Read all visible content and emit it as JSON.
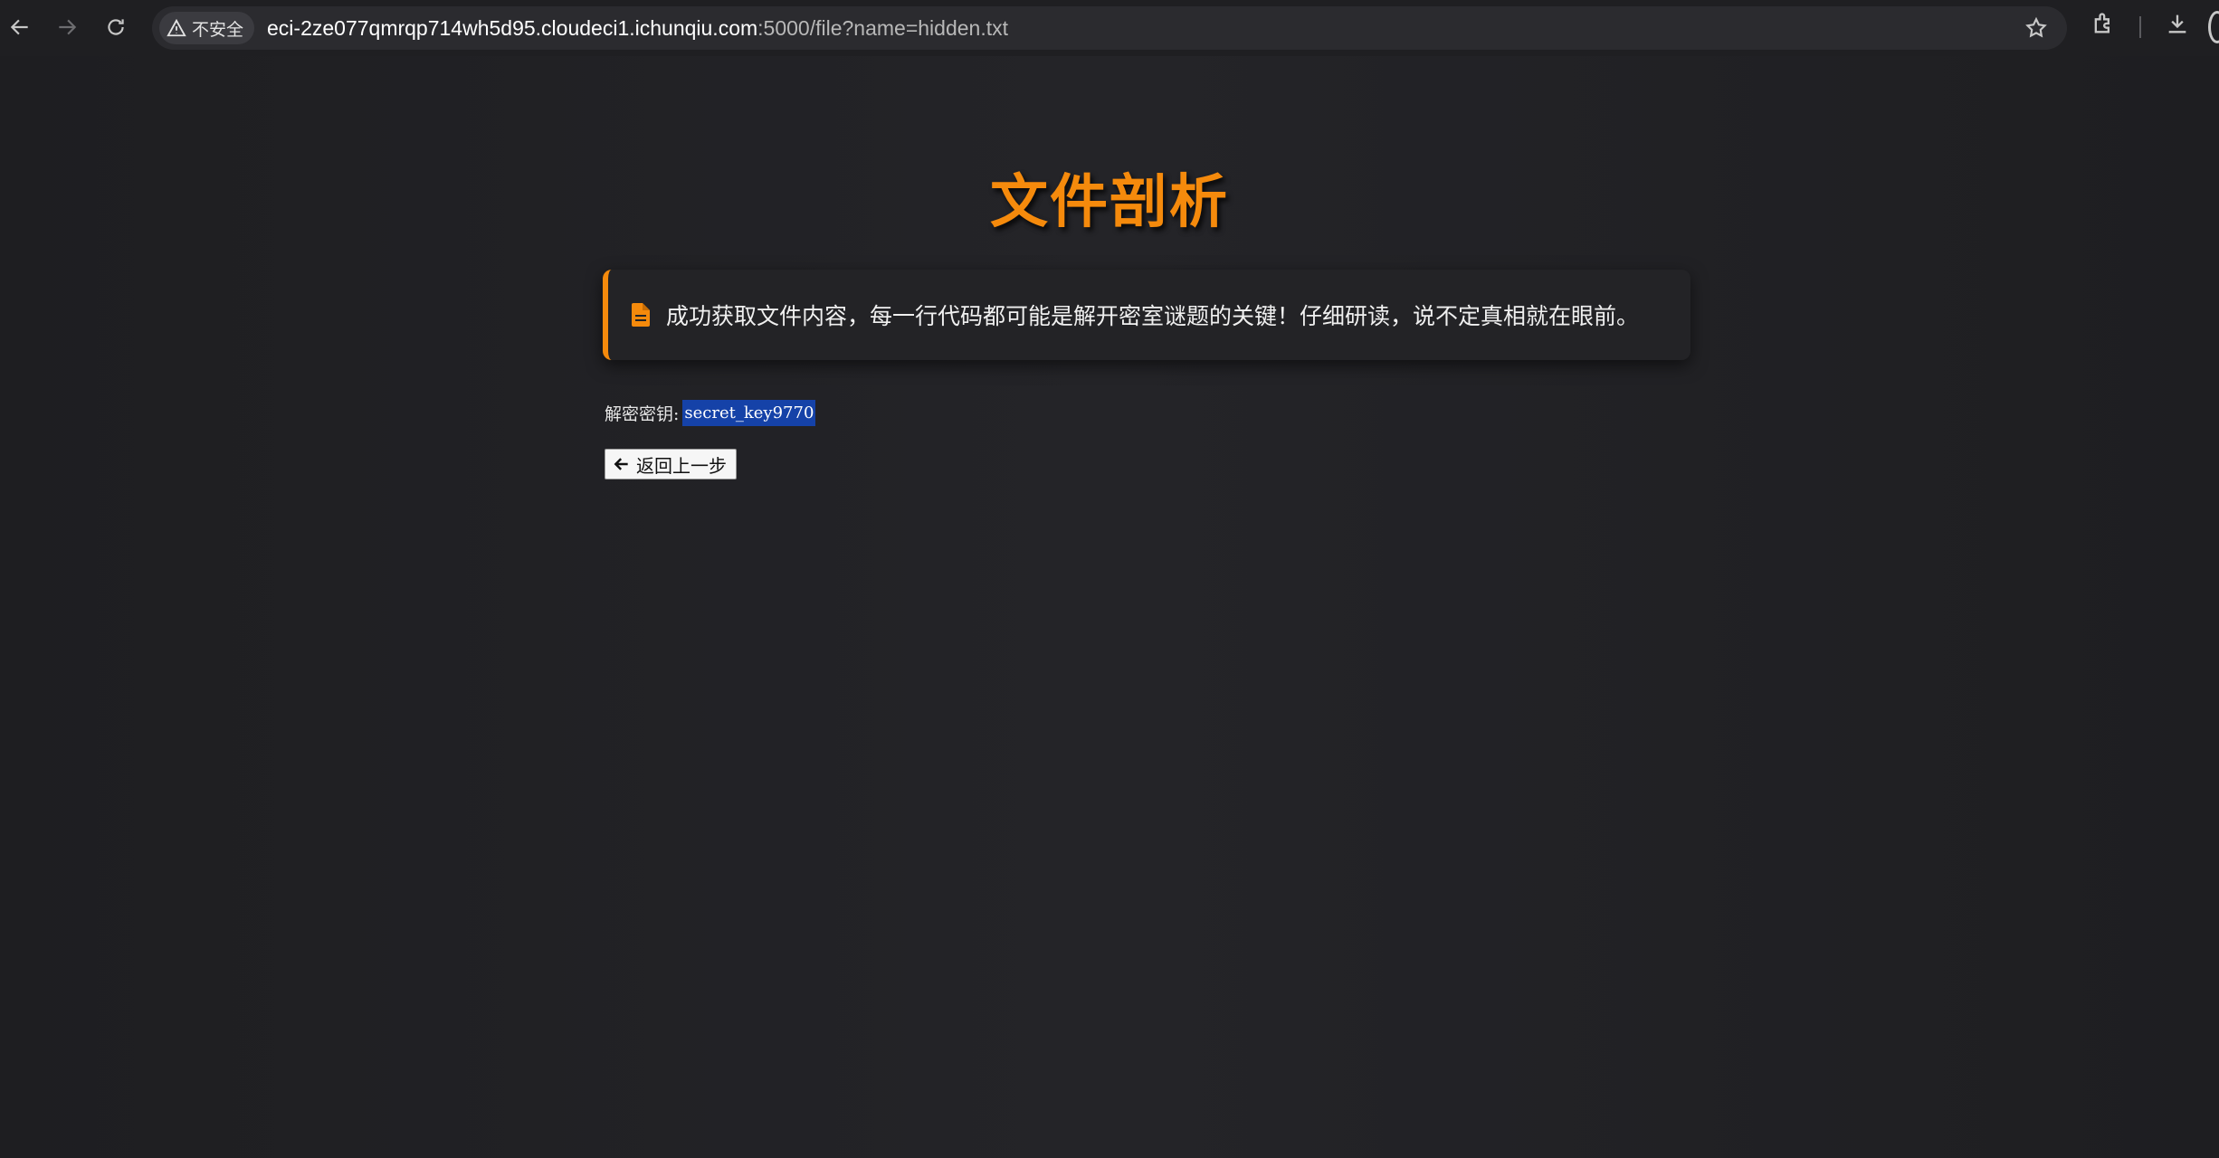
{
  "browser": {
    "security_label": "不安全",
    "url_host": "eci-2ze077qmrqp714wh5d95.cloudeci1.ichunqiu.com",
    "url_path": ":5000/file?name=hidden.txt"
  },
  "page": {
    "title": "文件剖析",
    "notice_text": "成功获取文件内容，每一行代码都可能是解开密室谜题的关键！仔细研读，说不定真相就在眼前。",
    "key_label": "解密密钥:",
    "key_value": "secret_key9770",
    "back_button_label": "返回上一步"
  },
  "colors": {
    "accent": "#f58a0c",
    "selection": "#1542a8",
    "background": "#1d1d20"
  }
}
